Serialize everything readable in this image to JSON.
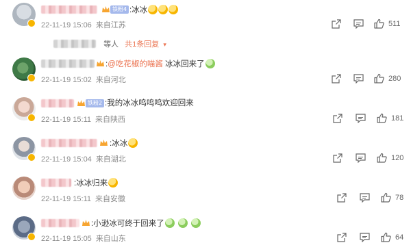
{
  "comments": [
    {
      "fan_badge": "铁粉4",
      "text": ":冰冰",
      "emoji_count": 3,
      "date": "22-11-19 15:06",
      "location": "来自江苏",
      "likes": "511"
    },
    {
      "fan_badge": "",
      "text_prefix": ":",
      "mention": "@吃花椒的喵酱",
      "text": " 冰冰回来了",
      "emoji_count": 1,
      "date": "22-11-19 15:02",
      "location": "来自河北",
      "likes": "280"
    },
    {
      "fan_badge": "铁粉2",
      "text": ":我的冰冰呜呜呜欢迎回来",
      "emoji_count": 0,
      "date": "22-11-19 15:11",
      "location": "来自陕西",
      "likes": "181"
    },
    {
      "fan_badge": "",
      "text": ":冰冰",
      "emoji_count": 1,
      "date": "22-11-19 15:04",
      "location": "来自湖北",
      "likes": "120"
    },
    {
      "fan_badge": "",
      "text": ":冰冰归来",
      "emoji_count": 1,
      "date": "22-11-19 15:11",
      "location": "来自安徽",
      "likes": "78"
    },
    {
      "fan_badge": "",
      "text": ":小逊冰可终于回来了",
      "emoji_count": 3,
      "date": "22-11-19 15:05",
      "location": "来自山东",
      "likes": "64"
    }
  ],
  "reply_summary": {
    "prefix": "等人",
    "link": "共1条回复",
    "arrow": "▾"
  },
  "icons": {
    "share": "share-icon",
    "comment": "comment-icon",
    "like": "thumbs-up-icon"
  },
  "colors": {
    "accent": "#eb7350",
    "meta": "#8a8a8a",
    "fan_badge": "#a5b9ec",
    "vip": "#f7b500"
  }
}
